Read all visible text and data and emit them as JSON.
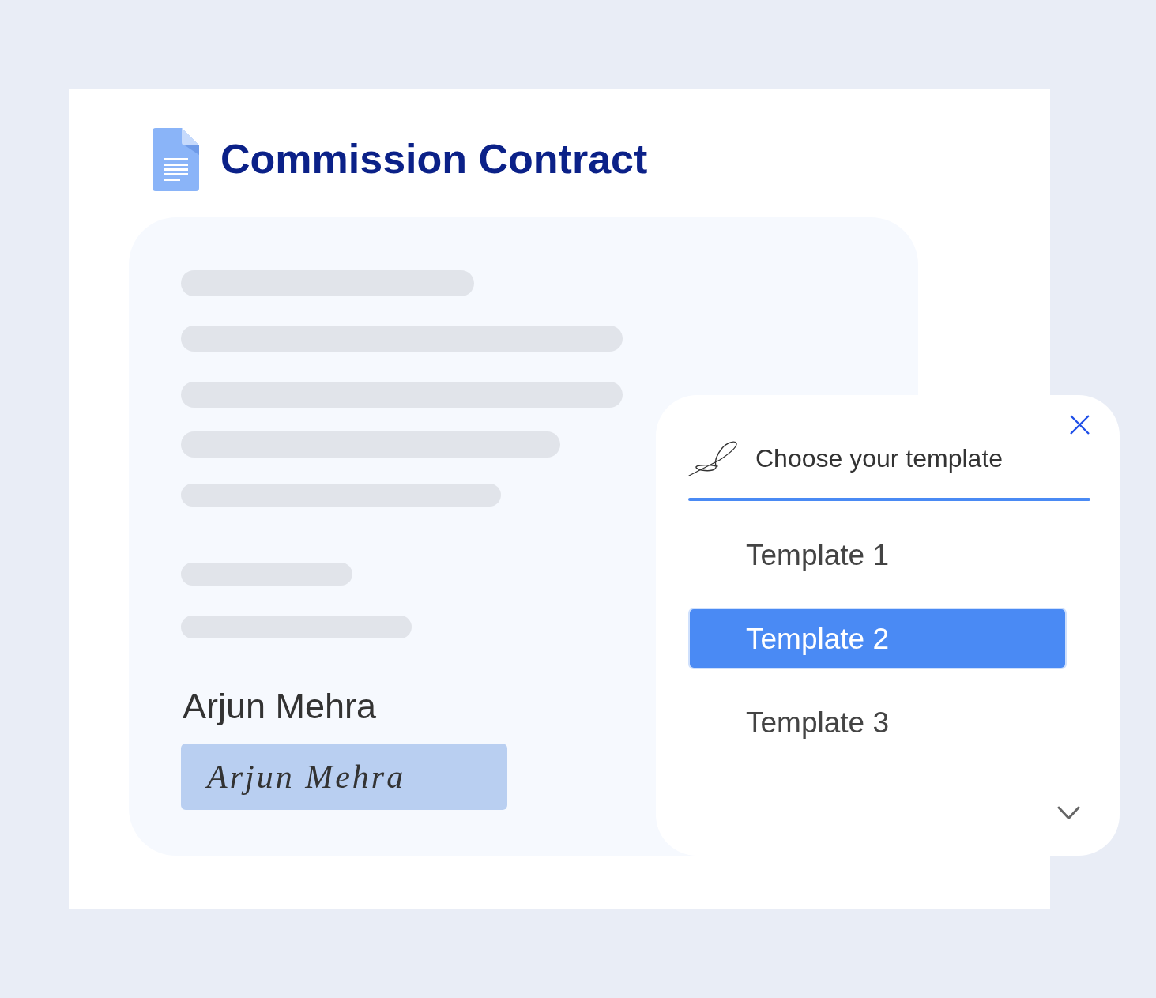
{
  "document": {
    "title": "Commission Contract",
    "signer_name": "Arjun Mehra",
    "signature": "Arjun Mehra"
  },
  "template_picker": {
    "title": "Choose your template",
    "options": [
      {
        "label": "Template 1",
        "selected": false
      },
      {
        "label": "Template 2",
        "selected": true
      },
      {
        "label": "Template 3",
        "selected": false
      }
    ]
  }
}
